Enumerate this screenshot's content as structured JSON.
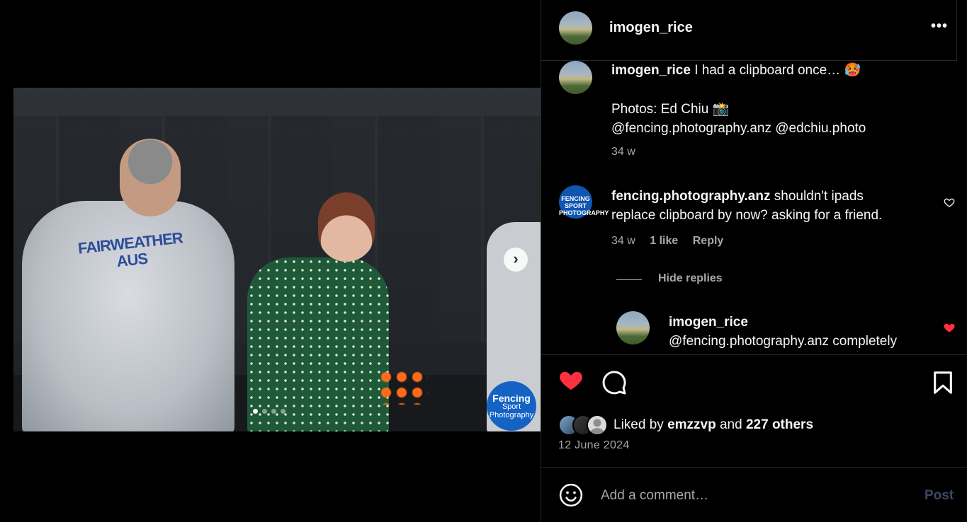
{
  "post": {
    "author": "imogen_rice",
    "more_label": "•••",
    "carousel": {
      "slides": 4,
      "current": 1
    },
    "watermark": {
      "line1": "Fencing",
      "line2": "Sport",
      "line3": "Photography"
    },
    "photo_text": {
      "jacket_line1": "FAIRWEATHER",
      "jacket_line2": "AUS"
    }
  },
  "caption": {
    "username": "imogen_rice",
    "text": "I had a clipboard once…",
    "emoji": "🥵",
    "credit_line": "Photos: Ed Chiu 📸",
    "mentions": "@fencing.photography.anz @edchiu.photo",
    "age": "34 w"
  },
  "comments": [
    {
      "username": "fencing.photography.anz",
      "line1": "shouldn't ipads",
      "line2": "replace clipboard by now? asking for a friend.",
      "age": "34 w",
      "likes": "1 like",
      "reply_label": "Reply",
      "avatar_text": "FENCING SPORT PHOTOGRAPHY",
      "liked": false,
      "replies_toggle": "Hide replies",
      "replies": [
        {
          "username": "imogen_rice",
          "text": "@fencing.photography.anz completely",
          "liked": true
        }
      ]
    }
  ],
  "actions": {
    "liked": true,
    "liked_by_prefix": "Liked by",
    "liked_by_user": "emzzvp",
    "and_label": "and",
    "others": "227 others",
    "date": "12 June 2024"
  },
  "composer": {
    "placeholder": "Add a comment…",
    "post_label": "Post"
  },
  "colors": {
    "like_red": "#ff3040",
    "post_disabled": "#3b4a63",
    "muted_text": "#a8a8a8"
  }
}
